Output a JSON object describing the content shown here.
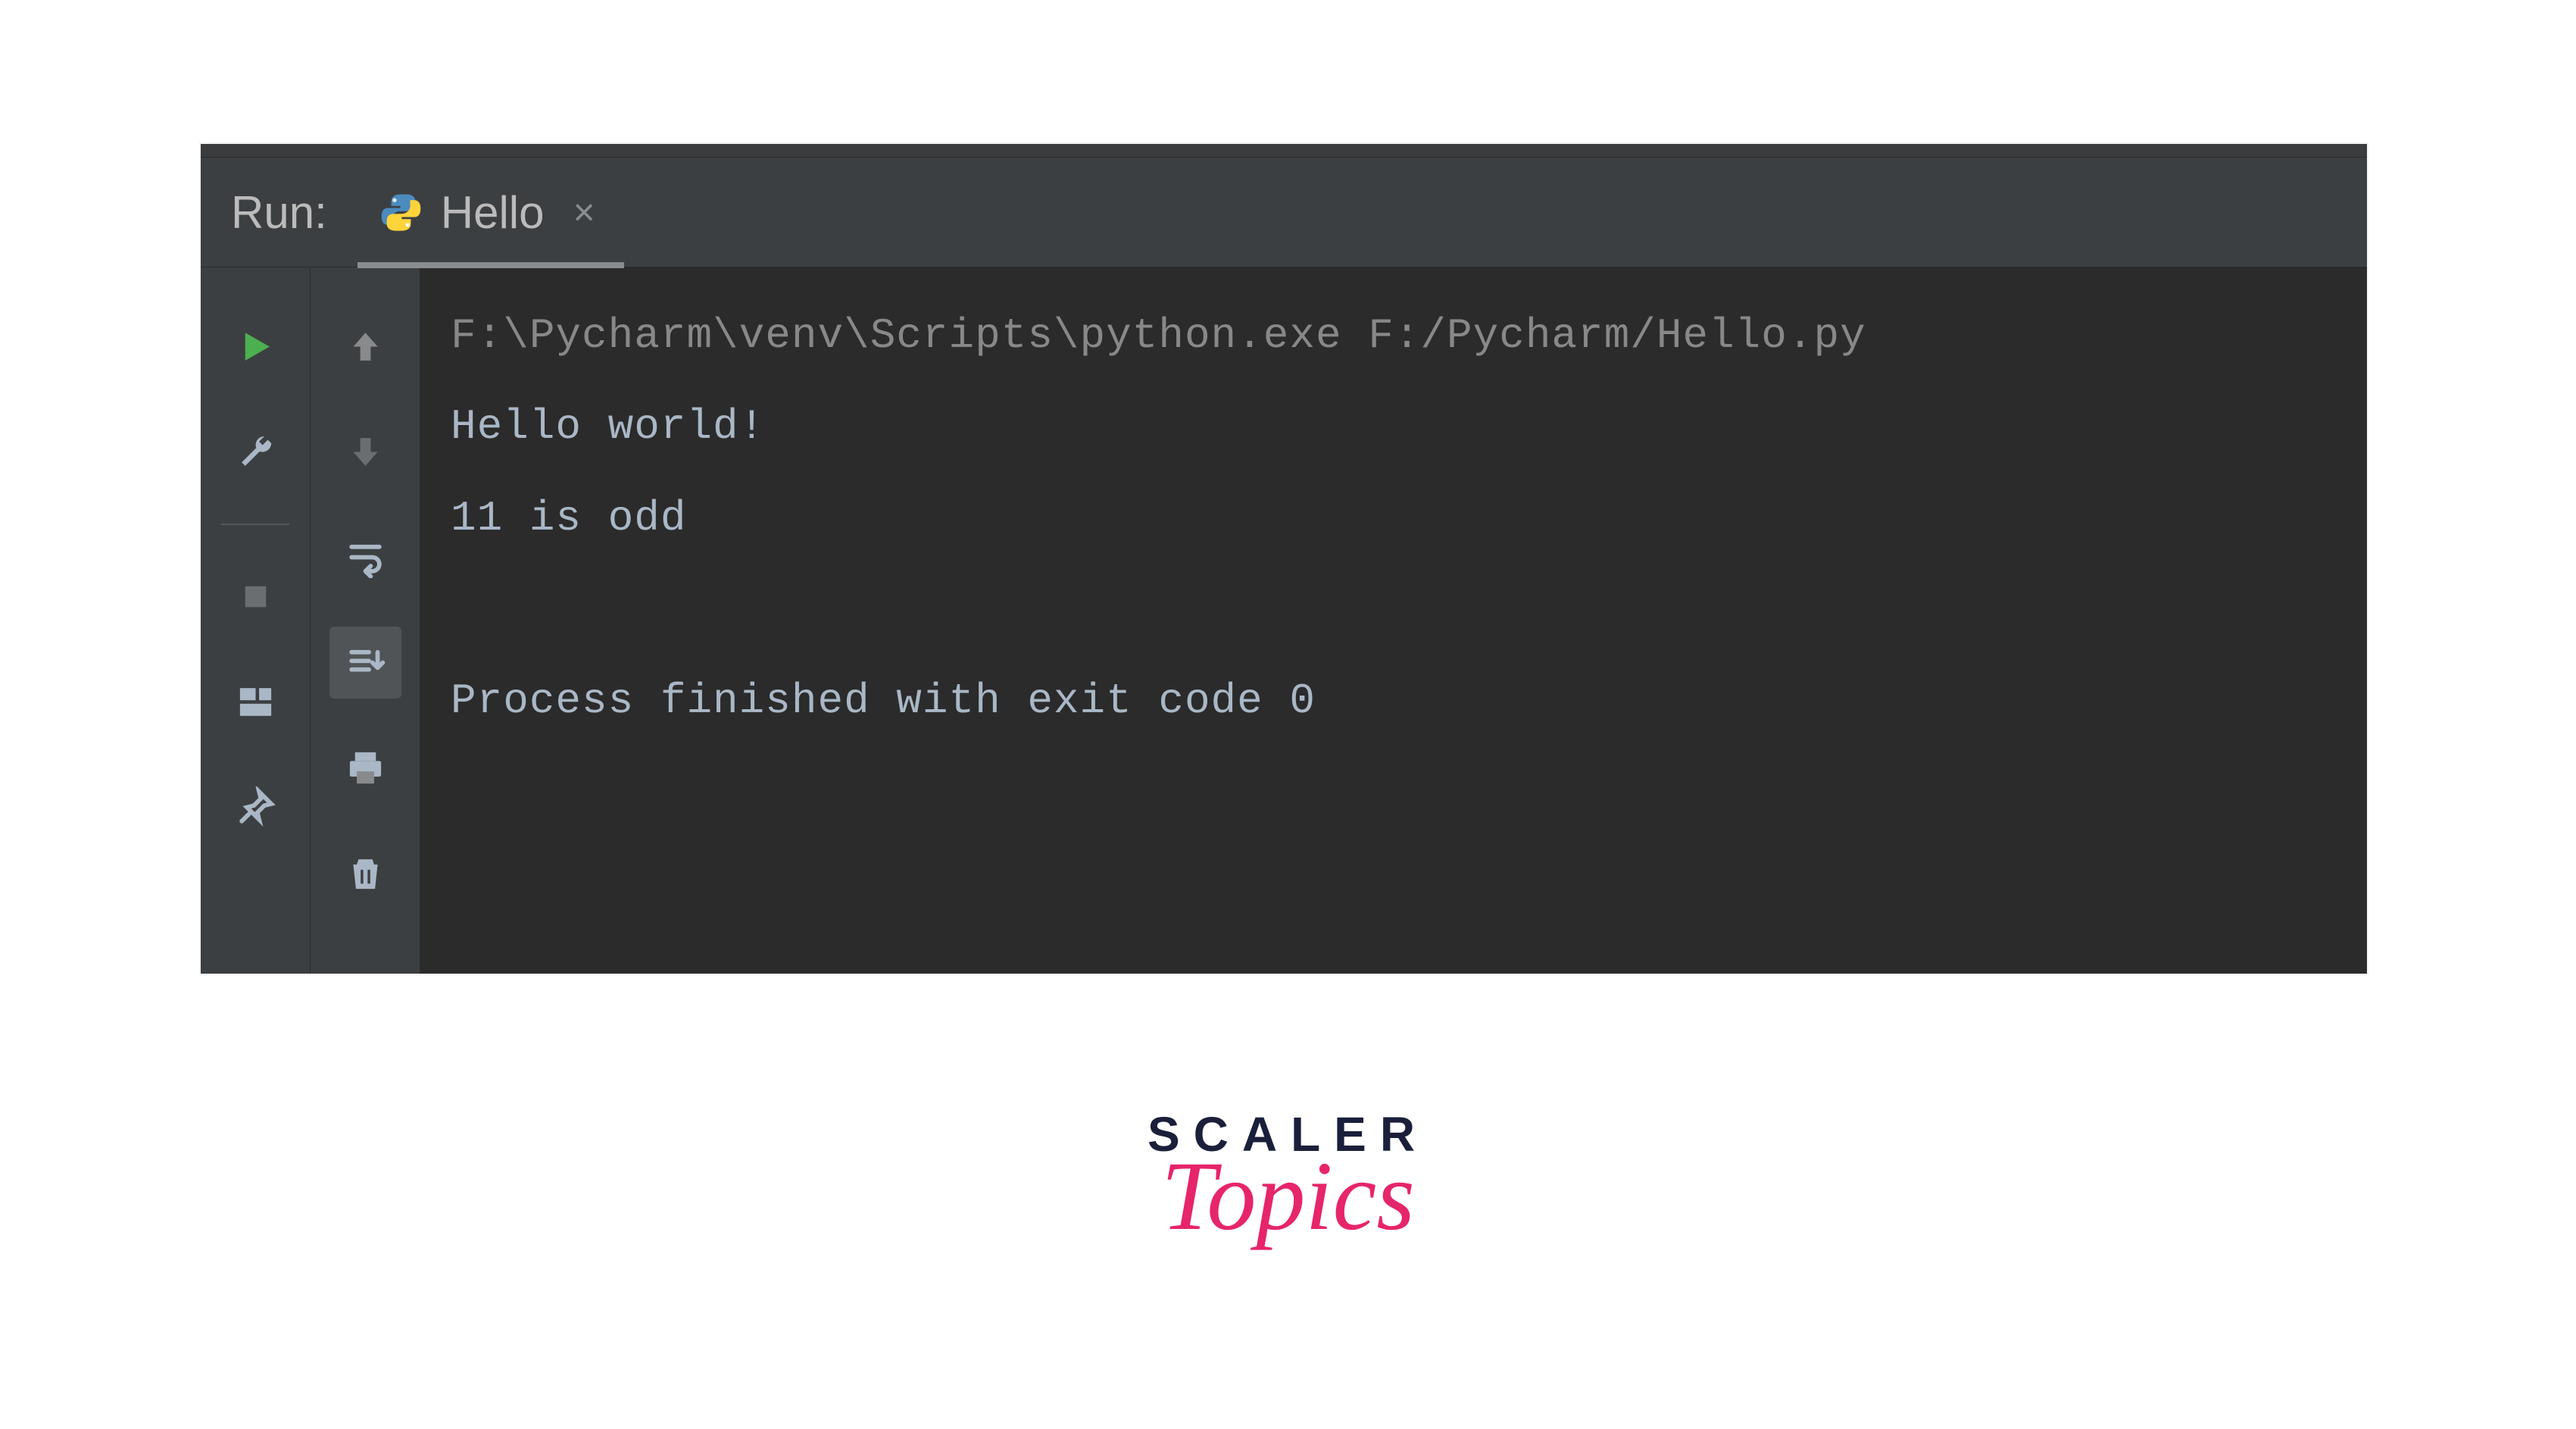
{
  "header": {
    "run_label": "Run:",
    "tab_label": "Hello"
  },
  "icons": {
    "python": "python-icon",
    "close_tab": "×",
    "rerun": "rerun-icon",
    "wrench": "wrench-icon",
    "stop": "stop-icon",
    "layout": "layout-icon",
    "pin": "pin-icon",
    "up": "up-arrow-icon",
    "down": "down-arrow-icon",
    "wrap": "soft-wrap-icon",
    "scroll_end": "scroll-to-end-icon",
    "print": "print-icon",
    "trash": "trash-icon"
  },
  "console": {
    "line1": "F:\\Pycharm\\venv\\Scripts\\python.exe F:/Pycharm/Hello.py",
    "line2": "Hello world!",
    "line3": "11 is odd",
    "line4": "",
    "line5": "Process finished with exit code 0"
  },
  "logo": {
    "line1": "SCALER",
    "line2": "Topics"
  },
  "colors": {
    "bg_dark": "#2b2b2b",
    "bg_panel": "#3c3f41",
    "text_soft": "#bbbbbb",
    "play_green": "#4caf50",
    "accent_pink": "#e6256b",
    "logo_navy": "#1a1f3a"
  }
}
